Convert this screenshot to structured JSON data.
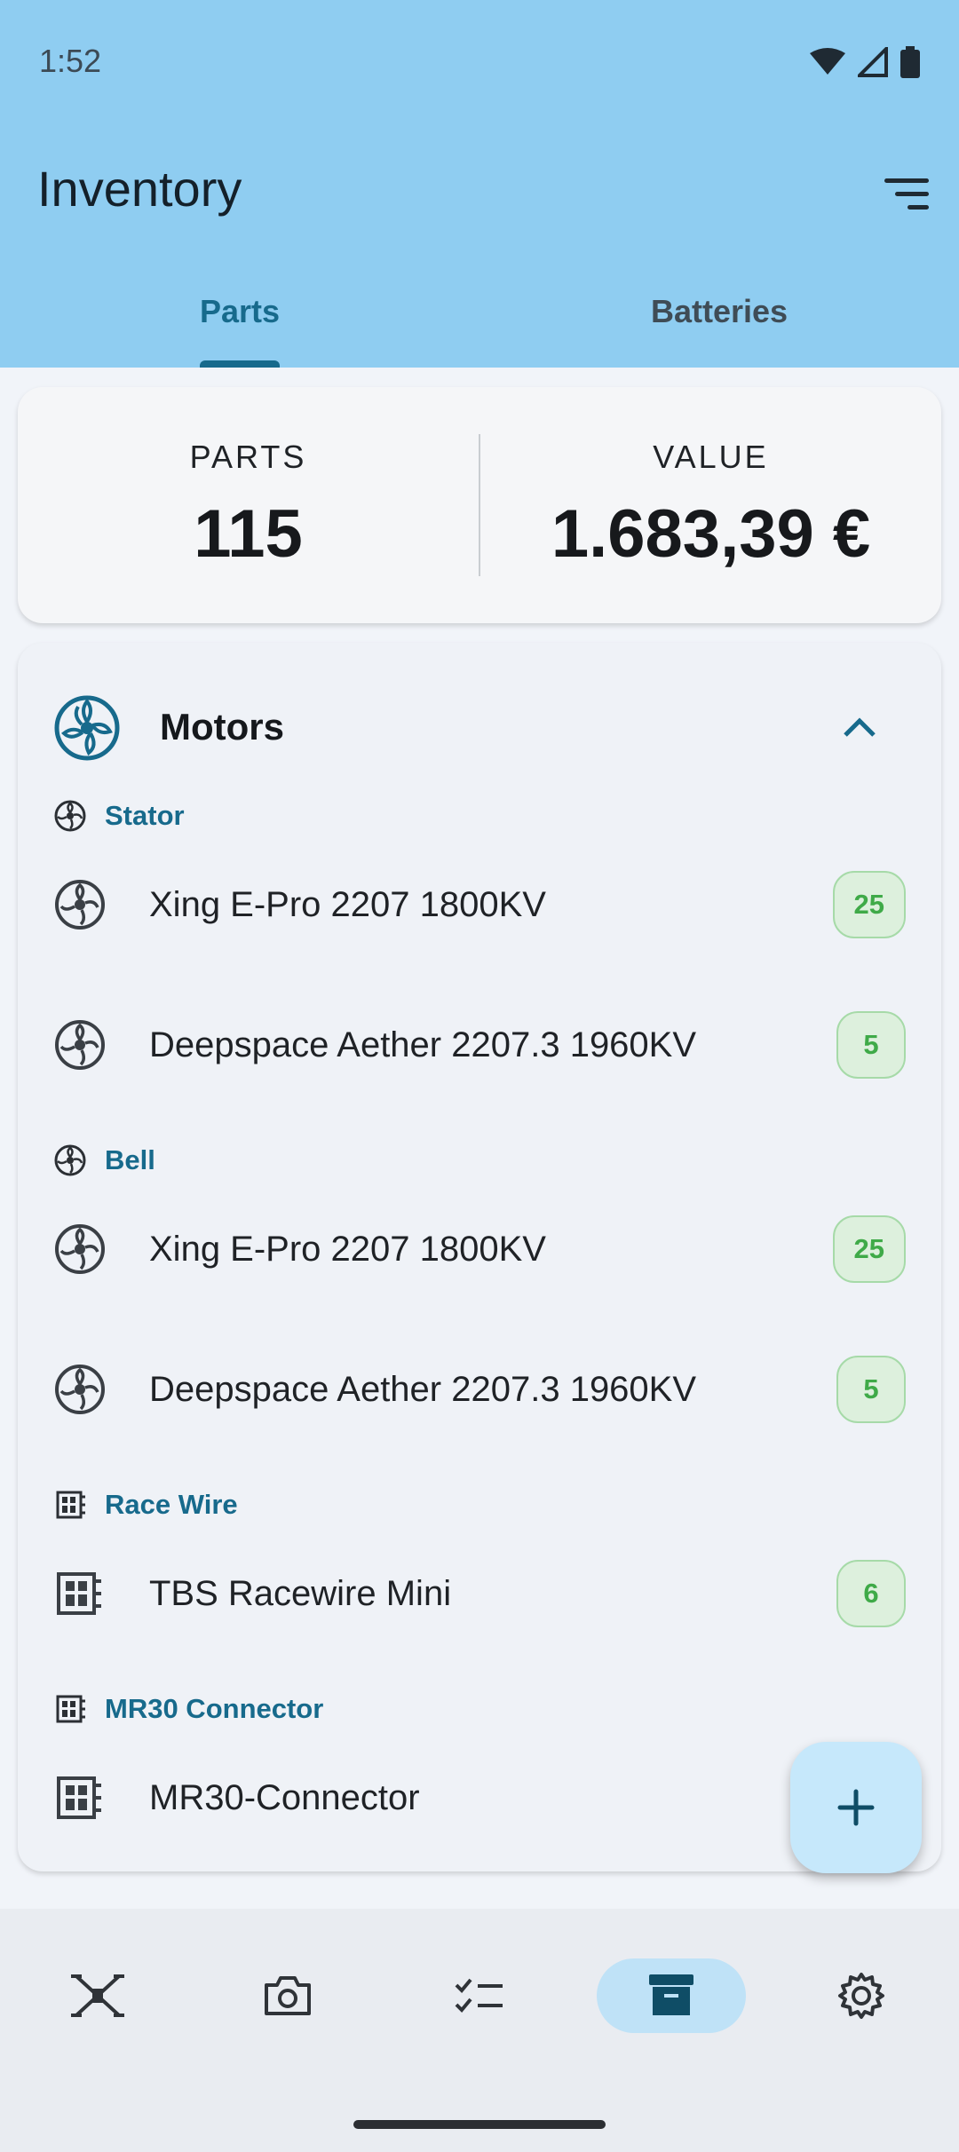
{
  "status_bar": {
    "time": "1:52",
    "icons": [
      "wifi-icon",
      "cell-signal-icon",
      "battery-icon"
    ]
  },
  "app_bar": {
    "title": "Inventory",
    "sort_icon": "sort-icon"
  },
  "tabs": [
    {
      "label": "Parts",
      "active": true
    },
    {
      "label": "Batteries",
      "active": false
    }
  ],
  "summary": {
    "parts_label": "PARTS",
    "parts_value": "115",
    "value_label": "VALUE",
    "value_value": "1.683,39 €"
  },
  "category": {
    "title": "Motors",
    "icon": "motor-icon",
    "expanded_icon": "chevron-up-icon",
    "groups": [
      {
        "label": "Stator",
        "icon": "motor-icon",
        "items": [
          {
            "name": "Xing E-Pro 2207 1800KV",
            "count": "25"
          },
          {
            "name": "Deepspace Aether 2207.3 1960KV",
            "count": "5"
          }
        ]
      },
      {
        "label": "Bell",
        "icon": "motor-icon",
        "items": [
          {
            "name": "Xing E-Pro 2207 1800KV",
            "count": "25"
          },
          {
            "name": "Deepspace Aether 2207.3 1960KV",
            "count": "5"
          }
        ]
      },
      {
        "label": "Race Wire",
        "icon": "chip-icon",
        "items": [
          {
            "name": "TBS Racewire Mini",
            "count": "6"
          }
        ]
      },
      {
        "label": "MR30 Connector",
        "icon": "chip-icon",
        "items": [
          {
            "name": "MR30-Connector",
            "count": ""
          }
        ]
      }
    ]
  },
  "fab": {
    "icon": "plus-icon"
  },
  "bottom_nav": [
    {
      "icon": "drone-icon",
      "active": false
    },
    {
      "icon": "camera-icon",
      "active": false
    },
    {
      "icon": "checklist-icon",
      "active": false
    },
    {
      "icon": "archive-icon",
      "active": true
    },
    {
      "icon": "gear-icon",
      "active": false
    }
  ],
  "colors": {
    "accent": "#176A8C",
    "header_bg": "#8FCDF1",
    "badge_text": "#3FAA48",
    "fab_bg": "#C6E8FB"
  }
}
